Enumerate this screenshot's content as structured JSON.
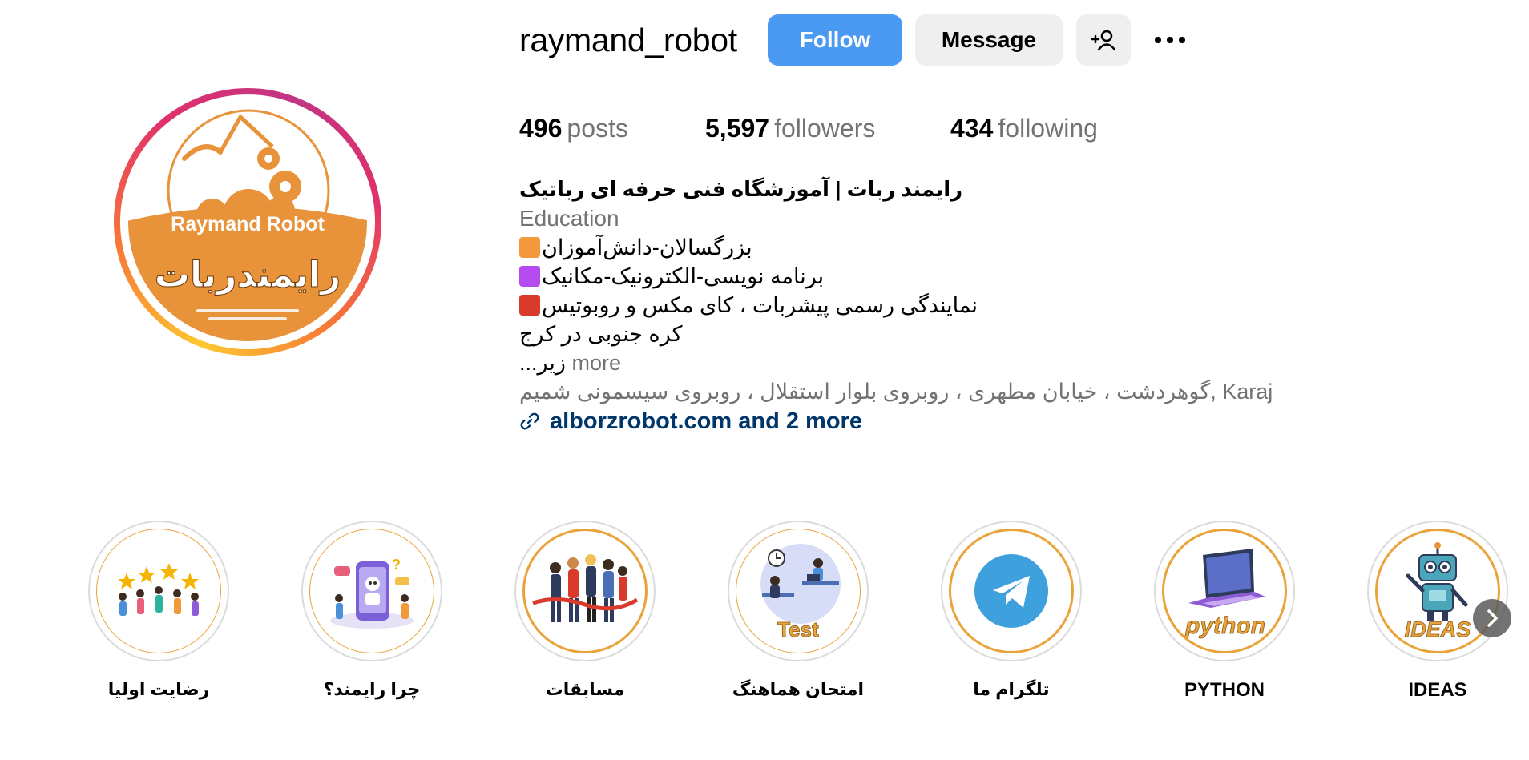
{
  "profile": {
    "username": "raymand_robot",
    "follow_label": "Follow",
    "message_label": "Message",
    "avatar_text_en": "Raymand Robot",
    "avatar_text_fa": "رایمندربات"
  },
  "stats": {
    "posts_count": "496",
    "posts_label": "posts",
    "followers_count": "5,597",
    "followers_label": "followers",
    "following_count": "434",
    "following_label": "following"
  },
  "bio": {
    "name": "رایمند ربات | آموزشگاه فنی حرفه ای رباتیک",
    "category": "Education",
    "line1": "بزرگسالان-دانش‌آموزان",
    "line2": "برنامه نویسی-الکترونیک-مکانیک",
    "line3": "نمایندگی رسمی پیشربات ، کای مکس و روبوتیس",
    "line4": "کره جنوبی در کرج",
    "line5_text": "...زیر",
    "more_label": "more",
    "address": "گوهردشت ، خیابان مطهری ، روبروی بلوار استقلال ، روبروی سیسمونی شمیم, Karaj",
    "link": "alborzrobot.com and 2 more",
    "square_colors": [
      "#f59a3c",
      "#b44cf0",
      "#d93a2b"
    ]
  },
  "highlights": [
    {
      "label": "رضایت اولیا",
      "icon": "happy-people-stars"
    },
    {
      "label": "چرا رایمند؟",
      "icon": "robot-phone"
    },
    {
      "label": "مسابقات",
      "icon": "finish-line-racers"
    },
    {
      "label": "امتحان هماهنگ",
      "icon": "students-test",
      "badge": "Test"
    },
    {
      "label": "تلگرام ما",
      "icon": "telegram-icon"
    },
    {
      "label": "PYTHON",
      "icon": "laptop",
      "badge": "python"
    },
    {
      "label": "IDEAS",
      "icon": "robot",
      "badge": "IDEAS"
    }
  ],
  "colors": {
    "follow_blue": "#4a9af4",
    "link_navy": "#00376b",
    "secondary_gray": "#737373",
    "brand_orange": "#e8923a"
  }
}
